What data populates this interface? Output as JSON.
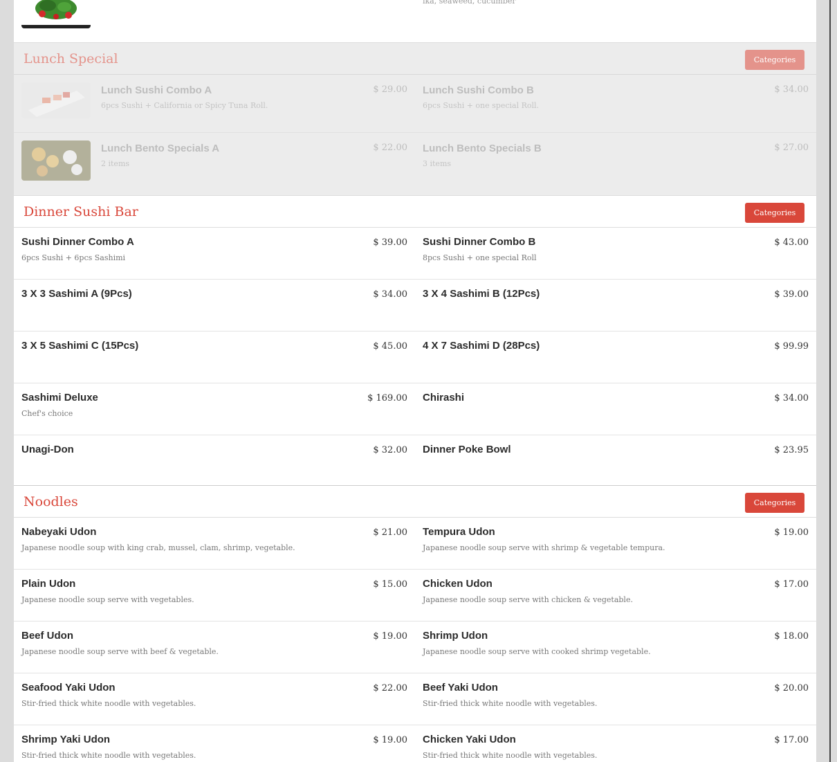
{
  "top_partial": {
    "desc": "ika, seaweed, cucumber"
  },
  "sections": {
    "lunch": {
      "title": "Lunch Special",
      "button": "Categories",
      "rows": [
        [
          {
            "name": "Lunch Sushi Combo A",
            "price": "$ 29.00",
            "desc": "6pcs Sushi + California or Spicy Tuna Roll."
          },
          {
            "name": "Lunch Sushi Combo B",
            "price": "$ 34.00",
            "desc": "6pcs Sushi + one special Roll."
          }
        ],
        [
          {
            "name": "Lunch Bento Specials A",
            "price": "$ 22.00",
            "desc": "2 items"
          },
          {
            "name": "Lunch Bento Specials B",
            "price": "$ 27.00",
            "desc": "3 items"
          }
        ]
      ]
    },
    "dinner": {
      "title": "Dinner Sushi Bar",
      "button": "Categories",
      "rows": [
        [
          {
            "name": "Sushi Dinner Combo A",
            "price": "$ 39.00",
            "desc": "6pcs Sushi + 6pcs Sashimi"
          },
          {
            "name": "Sushi Dinner Combo B",
            "price": "$ 43.00",
            "desc": "8pcs Sushi + one special Roll"
          }
        ],
        [
          {
            "name": "3 X 3 Sashimi A (9Pcs)",
            "price": "$ 34.00",
            "desc": ""
          },
          {
            "name": "3 X 4 Sashimi B (12Pcs)",
            "price": "$ 39.00",
            "desc": ""
          }
        ],
        [
          {
            "name": "3 X 5 Sashimi C (15Pcs)",
            "price": "$ 45.00",
            "desc": ""
          },
          {
            "name": "4 X 7 Sashimi D (28Pcs)",
            "price": "$ 99.99",
            "desc": ""
          }
        ],
        [
          {
            "name": "Sashimi Deluxe",
            "price": "$ 169.00",
            "desc": "Chef's choice"
          },
          {
            "name": "Chirashi",
            "price": "$ 34.00",
            "desc": ""
          }
        ],
        [
          {
            "name": "Unagi-Don",
            "price": "$ 32.00",
            "desc": ""
          },
          {
            "name": "Dinner Poke Bowl",
            "price": "$ 23.95",
            "desc": ""
          }
        ]
      ]
    },
    "noodles": {
      "title": "Noodles",
      "button": "Categories",
      "rows": [
        [
          {
            "name": "Nabeyaki Udon",
            "price": "$ 21.00",
            "desc": "Japanese noodle soup with king crab, mussel, clam, shrimp, vegetable."
          },
          {
            "name": "Tempura Udon",
            "price": "$ 19.00",
            "desc": "Japanese noodle soup serve with shrimp & vegetable tempura."
          }
        ],
        [
          {
            "name": "Plain Udon",
            "price": "$ 15.00",
            "desc": "Japanese noodle soup serve with vegetables."
          },
          {
            "name": "Chicken Udon",
            "price": "$ 17.00",
            "desc": "Japanese noodle soup serve with chicken & vegetable."
          }
        ],
        [
          {
            "name": "Beef Udon",
            "price": "$ 19.00",
            "desc": "Japanese noodle soup serve with beef & vegetable."
          },
          {
            "name": "Shrimp Udon",
            "price": "$ 18.00",
            "desc": "Japanese noodle soup serve with cooked shrimp vegetable."
          }
        ],
        [
          {
            "name": "Seafood Yaki Udon",
            "price": "$ 22.00",
            "desc": "Stir-fried thick white noodle with vegetables."
          },
          {
            "name": "Beef Yaki Udon",
            "price": "$ 20.00",
            "desc": "Stir-fried thick white noodle with vegetables."
          }
        ],
        [
          {
            "name": "Shrimp Yaki Udon",
            "price": "$ 19.00",
            "desc": "Stir-fried thick white noodle with vegetables."
          },
          {
            "name": "Chicken Yaki Udon",
            "price": "$ 17.00",
            "desc": "Stir-fried thick white noodle with vegetables."
          }
        ]
      ]
    }
  },
  "colors": {
    "accent": "#d9473a",
    "accent_faded": "#e4938b",
    "background": "#dcdcdc"
  }
}
